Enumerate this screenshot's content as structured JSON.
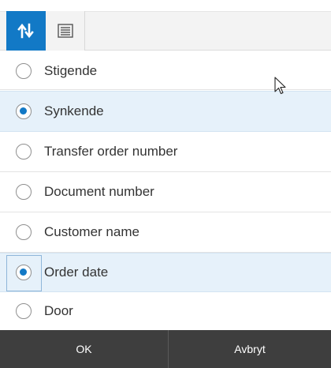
{
  "toolbar": {
    "sort_icon": "sort-arrows-icon",
    "list_icon": "list-view-icon",
    "accent_color": "#1279c6"
  },
  "options": [
    {
      "label": "Stigende",
      "selected": false
    },
    {
      "label": "Synkende",
      "selected": true
    },
    {
      "label": "Transfer order number",
      "selected": false
    },
    {
      "label": "Document number",
      "selected": false
    },
    {
      "label": "Customer name",
      "selected": false
    },
    {
      "label": "Order date",
      "selected": true
    },
    {
      "label": "Door",
      "selected": false
    }
  ],
  "footer": {
    "ok_label": "OK",
    "cancel_label": "Avbryt"
  }
}
